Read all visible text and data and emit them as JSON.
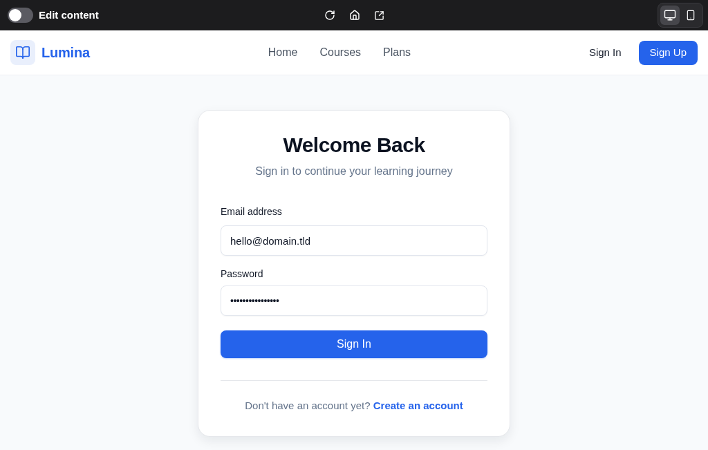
{
  "toolbar": {
    "edit_content": {
      "label": "Edit content",
      "on": false
    },
    "device_modes": [
      {
        "kind": "desktop",
        "selected": true
      },
      {
        "kind": "mobile",
        "selected": false
      }
    ]
  },
  "navbar": {
    "brand": "Lumina",
    "links": [
      "Home",
      "Courses",
      "Plans"
    ],
    "sign_in": "Sign In",
    "sign_up": "Sign Up"
  },
  "card": {
    "title": "Welcome Back",
    "subtitle": "Sign in to continue your learning journey",
    "fields": [
      {
        "kind": "email",
        "label": "Email address",
        "value": "hello@domain.tld"
      },
      {
        "kind": "password",
        "label": "Password",
        "value": "••••••••••••••••"
      }
    ],
    "submit": "Sign In",
    "footer": {
      "text": "Don't have an account yet?",
      "link": "Create an account"
    }
  }
}
